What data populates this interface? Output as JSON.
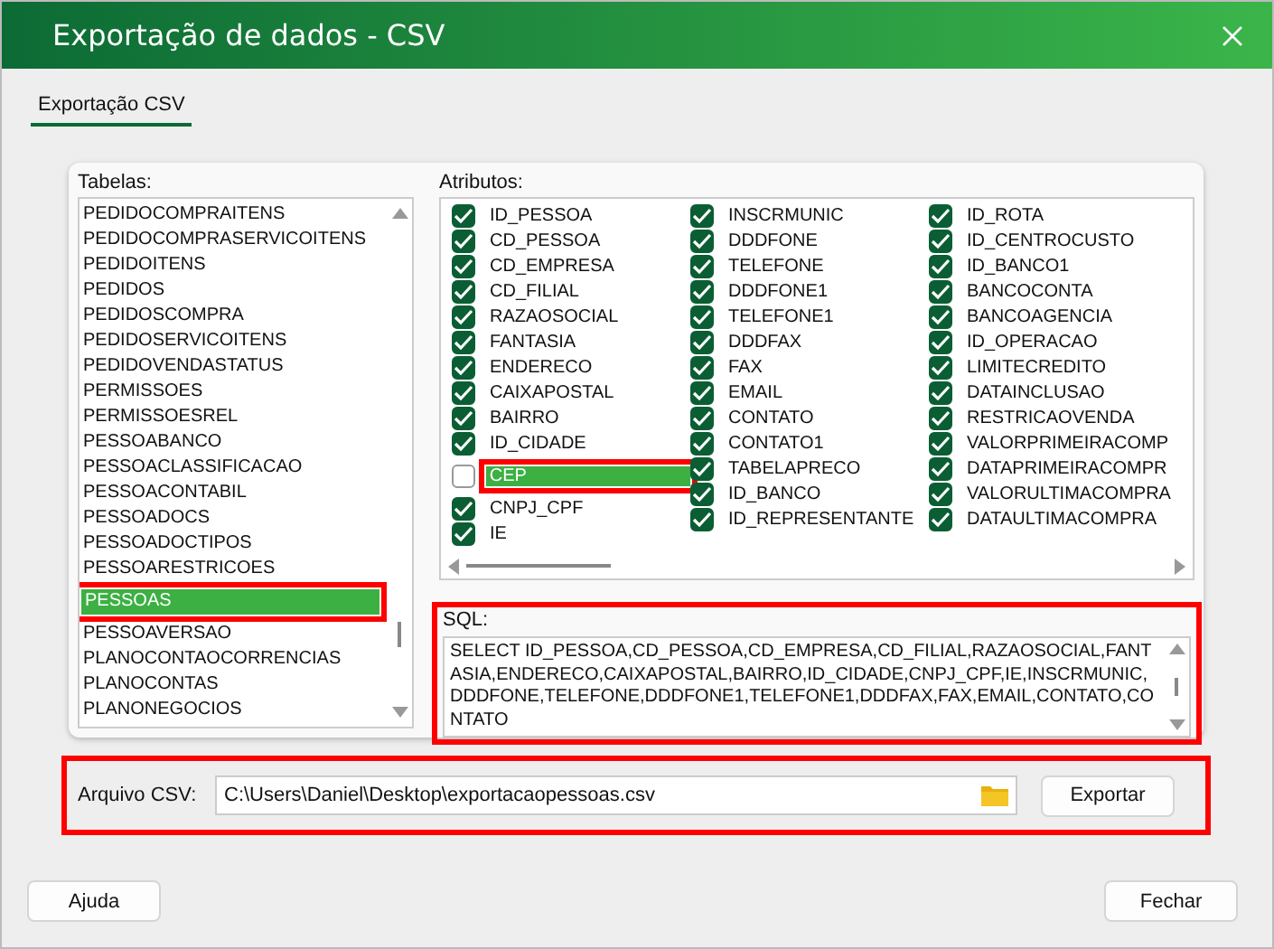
{
  "window": {
    "title": "Exportação de dados - CSV"
  },
  "tabs": [
    {
      "label": "Exportação CSV",
      "selected": true
    }
  ],
  "tables": {
    "label": "Tabelas:",
    "items": [
      {
        "name": "PEDIDOCOMPRAITENS",
        "selected": false
      },
      {
        "name": "PEDIDOCOMPRASERVICOITENS",
        "selected": false
      },
      {
        "name": "PEDIDOITENS",
        "selected": false
      },
      {
        "name": "PEDIDOS",
        "selected": false
      },
      {
        "name": "PEDIDOSCOMPRA",
        "selected": false
      },
      {
        "name": "PEDIDOSERVICOITENS",
        "selected": false
      },
      {
        "name": "PEDIDOVENDASTATUS",
        "selected": false
      },
      {
        "name": "PERMISSOES",
        "selected": false
      },
      {
        "name": "PERMISSOESREL",
        "selected": false
      },
      {
        "name": "PESSOABANCO",
        "selected": false
      },
      {
        "name": "PESSOACLASSIFICACAO",
        "selected": false
      },
      {
        "name": "PESSOACONTABIL",
        "selected": false
      },
      {
        "name": "PESSOADOCS",
        "selected": false
      },
      {
        "name": "PESSOADOCTIPOS",
        "selected": false
      },
      {
        "name": "PESSOARESTRICOES",
        "selected": false
      },
      {
        "name": "PESSOAS",
        "selected": true
      },
      {
        "name": "PESSOAVERSAO",
        "selected": false
      },
      {
        "name": "PLANOCONTAOCORRENCIAS",
        "selected": false
      },
      {
        "name": "PLANOCONTAS",
        "selected": false
      },
      {
        "name": "PLANONEGOCIOS",
        "selected": false
      }
    ]
  },
  "attributes": {
    "label": "Atributos:",
    "columns": [
      [
        {
          "name": "ID_PESSOA",
          "checked": true,
          "selected": false
        },
        {
          "name": "CD_PESSOA",
          "checked": true,
          "selected": false
        },
        {
          "name": "CD_EMPRESA",
          "checked": true,
          "selected": false
        },
        {
          "name": "CD_FILIAL",
          "checked": true,
          "selected": false
        },
        {
          "name": "RAZAOSOCIAL",
          "checked": true,
          "selected": false
        },
        {
          "name": "FANTASIA",
          "checked": true,
          "selected": false
        },
        {
          "name": "ENDERECO",
          "checked": true,
          "selected": false
        },
        {
          "name": "CAIXAPOSTAL",
          "checked": true,
          "selected": false
        },
        {
          "name": "BAIRRO",
          "checked": true,
          "selected": false
        },
        {
          "name": "ID_CIDADE",
          "checked": true,
          "selected": false
        },
        {
          "name": "CEP",
          "checked": false,
          "selected": true
        },
        {
          "name": "CNPJ_CPF",
          "checked": true,
          "selected": false
        },
        {
          "name": "IE",
          "checked": true,
          "selected": false
        }
      ],
      [
        {
          "name": "INSCRMUNIC",
          "checked": true,
          "selected": false
        },
        {
          "name": "DDDFONE",
          "checked": true,
          "selected": false
        },
        {
          "name": "TELEFONE",
          "checked": true,
          "selected": false
        },
        {
          "name": "DDDFONE1",
          "checked": true,
          "selected": false
        },
        {
          "name": "TELEFONE1",
          "checked": true,
          "selected": false
        },
        {
          "name": "DDDFAX",
          "checked": true,
          "selected": false
        },
        {
          "name": "FAX",
          "checked": true,
          "selected": false
        },
        {
          "name": "EMAIL",
          "checked": true,
          "selected": false
        },
        {
          "name": "CONTATO",
          "checked": true,
          "selected": false
        },
        {
          "name": "CONTATO1",
          "checked": true,
          "selected": false
        },
        {
          "name": "TABELAPRECO",
          "checked": true,
          "selected": false
        },
        {
          "name": "ID_BANCO",
          "checked": true,
          "selected": false
        },
        {
          "name": "ID_REPRESENTANTE",
          "checked": true,
          "selected": false
        }
      ],
      [
        {
          "name": "ID_ROTA",
          "checked": true,
          "selected": false
        },
        {
          "name": "ID_CENTROCUSTO",
          "checked": true,
          "selected": false
        },
        {
          "name": "ID_BANCO1",
          "checked": true,
          "selected": false
        },
        {
          "name": "BANCOCONTA",
          "checked": true,
          "selected": false
        },
        {
          "name": "BANCOAGENCIA",
          "checked": true,
          "selected": false
        },
        {
          "name": "ID_OPERACAO",
          "checked": true,
          "selected": false
        },
        {
          "name": "LIMITECREDITO",
          "checked": true,
          "selected": false
        },
        {
          "name": "DATAINCLUSAO",
          "checked": true,
          "selected": false
        },
        {
          "name": "RESTRICAOVENDA",
          "checked": true,
          "selected": false
        },
        {
          "name": "VALORPRIMEIRACOMP",
          "checked": true,
          "selected": false
        },
        {
          "name": "DATAPRIMEIRACOMPR",
          "checked": true,
          "selected": false
        },
        {
          "name": "VALORULTIMACOMPRA",
          "checked": true,
          "selected": false
        },
        {
          "name": "DATAULTIMACOMPRA",
          "checked": true,
          "selected": false
        }
      ]
    ]
  },
  "sql": {
    "label": "SQL:",
    "text": "SELECT ID_PESSOA,CD_PESSOA,CD_EMPRESA,CD_FILIAL,RAZAOSOCIAL,FANTASIA,ENDERECO,CAIXAPOSTAL,BAIRRO,ID_CIDADE,CNPJ_CPF,IE,INSCRMUNIC,DDDFONE,TELEFONE,DDDFONE1,TELEFONE1,DDDFAX,FAX,EMAIL,CONTATO,CONTATO",
    "highlighted": true
  },
  "file": {
    "label": "Arquivo CSV:",
    "value": "C:\\Users\\Daniel\\Desktop\\exportacaopessoas.csv",
    "button": "Exportar",
    "highlighted": true
  },
  "buttons": {
    "help": "Ajuda",
    "close": "Fechar"
  }
}
